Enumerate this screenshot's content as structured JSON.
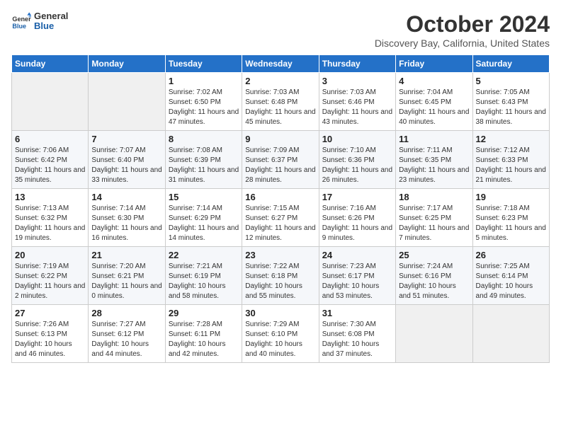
{
  "logo": {
    "text_general": "General",
    "text_blue": "Blue"
  },
  "header": {
    "month": "October 2024",
    "location": "Discovery Bay, California, United States"
  },
  "columns": [
    "Sunday",
    "Monday",
    "Tuesday",
    "Wednesday",
    "Thursday",
    "Friday",
    "Saturday"
  ],
  "weeks": [
    [
      {
        "day": "",
        "sunrise": "",
        "sunset": "",
        "daylight": ""
      },
      {
        "day": "",
        "sunrise": "",
        "sunset": "",
        "daylight": ""
      },
      {
        "day": "1",
        "sunrise": "Sunrise: 7:02 AM",
        "sunset": "Sunset: 6:50 PM",
        "daylight": "Daylight: 11 hours and 47 minutes."
      },
      {
        "day": "2",
        "sunrise": "Sunrise: 7:03 AM",
        "sunset": "Sunset: 6:48 PM",
        "daylight": "Daylight: 11 hours and 45 minutes."
      },
      {
        "day": "3",
        "sunrise": "Sunrise: 7:03 AM",
        "sunset": "Sunset: 6:46 PM",
        "daylight": "Daylight: 11 hours and 43 minutes."
      },
      {
        "day": "4",
        "sunrise": "Sunrise: 7:04 AM",
        "sunset": "Sunset: 6:45 PM",
        "daylight": "Daylight: 11 hours and 40 minutes."
      },
      {
        "day": "5",
        "sunrise": "Sunrise: 7:05 AM",
        "sunset": "Sunset: 6:43 PM",
        "daylight": "Daylight: 11 hours and 38 minutes."
      }
    ],
    [
      {
        "day": "6",
        "sunrise": "Sunrise: 7:06 AM",
        "sunset": "Sunset: 6:42 PM",
        "daylight": "Daylight: 11 hours and 35 minutes."
      },
      {
        "day": "7",
        "sunrise": "Sunrise: 7:07 AM",
        "sunset": "Sunset: 6:40 PM",
        "daylight": "Daylight: 11 hours and 33 minutes."
      },
      {
        "day": "8",
        "sunrise": "Sunrise: 7:08 AM",
        "sunset": "Sunset: 6:39 PM",
        "daylight": "Daylight: 11 hours and 31 minutes."
      },
      {
        "day": "9",
        "sunrise": "Sunrise: 7:09 AM",
        "sunset": "Sunset: 6:37 PM",
        "daylight": "Daylight: 11 hours and 28 minutes."
      },
      {
        "day": "10",
        "sunrise": "Sunrise: 7:10 AM",
        "sunset": "Sunset: 6:36 PM",
        "daylight": "Daylight: 11 hours and 26 minutes."
      },
      {
        "day": "11",
        "sunrise": "Sunrise: 7:11 AM",
        "sunset": "Sunset: 6:35 PM",
        "daylight": "Daylight: 11 hours and 23 minutes."
      },
      {
        "day": "12",
        "sunrise": "Sunrise: 7:12 AM",
        "sunset": "Sunset: 6:33 PM",
        "daylight": "Daylight: 11 hours and 21 minutes."
      }
    ],
    [
      {
        "day": "13",
        "sunrise": "Sunrise: 7:13 AM",
        "sunset": "Sunset: 6:32 PM",
        "daylight": "Daylight: 11 hours and 19 minutes."
      },
      {
        "day": "14",
        "sunrise": "Sunrise: 7:14 AM",
        "sunset": "Sunset: 6:30 PM",
        "daylight": "Daylight: 11 hours and 16 minutes."
      },
      {
        "day": "15",
        "sunrise": "Sunrise: 7:14 AM",
        "sunset": "Sunset: 6:29 PM",
        "daylight": "Daylight: 11 hours and 14 minutes."
      },
      {
        "day": "16",
        "sunrise": "Sunrise: 7:15 AM",
        "sunset": "Sunset: 6:27 PM",
        "daylight": "Daylight: 11 hours and 12 minutes."
      },
      {
        "day": "17",
        "sunrise": "Sunrise: 7:16 AM",
        "sunset": "Sunset: 6:26 PM",
        "daylight": "Daylight: 11 hours and 9 minutes."
      },
      {
        "day": "18",
        "sunrise": "Sunrise: 7:17 AM",
        "sunset": "Sunset: 6:25 PM",
        "daylight": "Daylight: 11 hours and 7 minutes."
      },
      {
        "day": "19",
        "sunrise": "Sunrise: 7:18 AM",
        "sunset": "Sunset: 6:23 PM",
        "daylight": "Daylight: 11 hours and 5 minutes."
      }
    ],
    [
      {
        "day": "20",
        "sunrise": "Sunrise: 7:19 AM",
        "sunset": "Sunset: 6:22 PM",
        "daylight": "Daylight: 11 hours and 2 minutes."
      },
      {
        "day": "21",
        "sunrise": "Sunrise: 7:20 AM",
        "sunset": "Sunset: 6:21 PM",
        "daylight": "Daylight: 11 hours and 0 minutes."
      },
      {
        "day": "22",
        "sunrise": "Sunrise: 7:21 AM",
        "sunset": "Sunset: 6:19 PM",
        "daylight": "Daylight: 10 hours and 58 minutes."
      },
      {
        "day": "23",
        "sunrise": "Sunrise: 7:22 AM",
        "sunset": "Sunset: 6:18 PM",
        "daylight": "Daylight: 10 hours and 55 minutes."
      },
      {
        "day": "24",
        "sunrise": "Sunrise: 7:23 AM",
        "sunset": "Sunset: 6:17 PM",
        "daylight": "Daylight: 10 hours and 53 minutes."
      },
      {
        "day": "25",
        "sunrise": "Sunrise: 7:24 AM",
        "sunset": "Sunset: 6:16 PM",
        "daylight": "Daylight: 10 hours and 51 minutes."
      },
      {
        "day": "26",
        "sunrise": "Sunrise: 7:25 AM",
        "sunset": "Sunset: 6:14 PM",
        "daylight": "Daylight: 10 hours and 49 minutes."
      }
    ],
    [
      {
        "day": "27",
        "sunrise": "Sunrise: 7:26 AM",
        "sunset": "Sunset: 6:13 PM",
        "daylight": "Daylight: 10 hours and 46 minutes."
      },
      {
        "day": "28",
        "sunrise": "Sunrise: 7:27 AM",
        "sunset": "Sunset: 6:12 PM",
        "daylight": "Daylight: 10 hours and 44 minutes."
      },
      {
        "day": "29",
        "sunrise": "Sunrise: 7:28 AM",
        "sunset": "Sunset: 6:11 PM",
        "daylight": "Daylight: 10 hours and 42 minutes."
      },
      {
        "day": "30",
        "sunrise": "Sunrise: 7:29 AM",
        "sunset": "Sunset: 6:10 PM",
        "daylight": "Daylight: 10 hours and 40 minutes."
      },
      {
        "day": "31",
        "sunrise": "Sunrise: 7:30 AM",
        "sunset": "Sunset: 6:08 PM",
        "daylight": "Daylight: 10 hours and 37 minutes."
      },
      {
        "day": "",
        "sunrise": "",
        "sunset": "",
        "daylight": ""
      },
      {
        "day": "",
        "sunrise": "",
        "sunset": "",
        "daylight": ""
      }
    ]
  ]
}
